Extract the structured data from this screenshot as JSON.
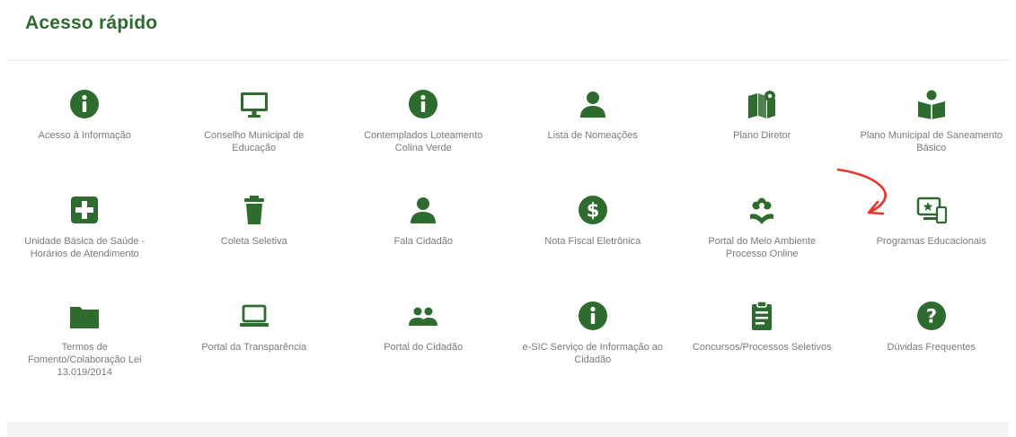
{
  "section": {
    "title": "Acesso rápido"
  },
  "accent_color": "#2e6b2e",
  "tiles": [
    {
      "label": "Acesso à Informação",
      "icon": "info-circle-icon"
    },
    {
      "label": "Conselho Municipal de Educação",
      "icon": "monitor-icon"
    },
    {
      "label": "Contemplados Loteamento Colina Verde",
      "icon": "info-circle-icon"
    },
    {
      "label": "Lista de Nomeações",
      "icon": "user-icon"
    },
    {
      "label": "Plano Diretor",
      "icon": "map-marker-icon"
    },
    {
      "label": "Plano Municipal de Saneamento Básico",
      "icon": "reading-person-icon"
    },
    {
      "label": "Unidade Básica de Saúde - Horários de Atendimento",
      "icon": "medical-plus-icon"
    },
    {
      "label": "Coleta Seletiva",
      "icon": "trash-icon"
    },
    {
      "label": "Fala Cidadão",
      "icon": "user-icon"
    },
    {
      "label": "Nota Fiscal Eletrônica",
      "icon": "dollar-circle-icon"
    },
    {
      "label": "Portal do Meio Ambiente Processo Online",
      "icon": "flower-hand-icon"
    },
    {
      "label": "Programas Educacionais",
      "icon": "education-screen-icon"
    },
    {
      "label": "Termos de Fomento/Colaboração Lei 13.019/2014",
      "icon": "folder-icon"
    },
    {
      "label": "Portal da Transparência",
      "icon": "laptop-icon"
    },
    {
      "label": "Portal do Cidadão",
      "icon": "people-icon"
    },
    {
      "label": "e-SIC Serviço de Informação ao Cidadão",
      "icon": "info-circle-icon"
    },
    {
      "label": "Concursos/Processos Seletivos",
      "icon": "clipboard-icon"
    },
    {
      "label": "Dúvidas Frequentes",
      "icon": "question-circle-icon"
    }
  ],
  "annotation": {
    "icon": "red-arrow-icon",
    "color": "#e8342a"
  }
}
